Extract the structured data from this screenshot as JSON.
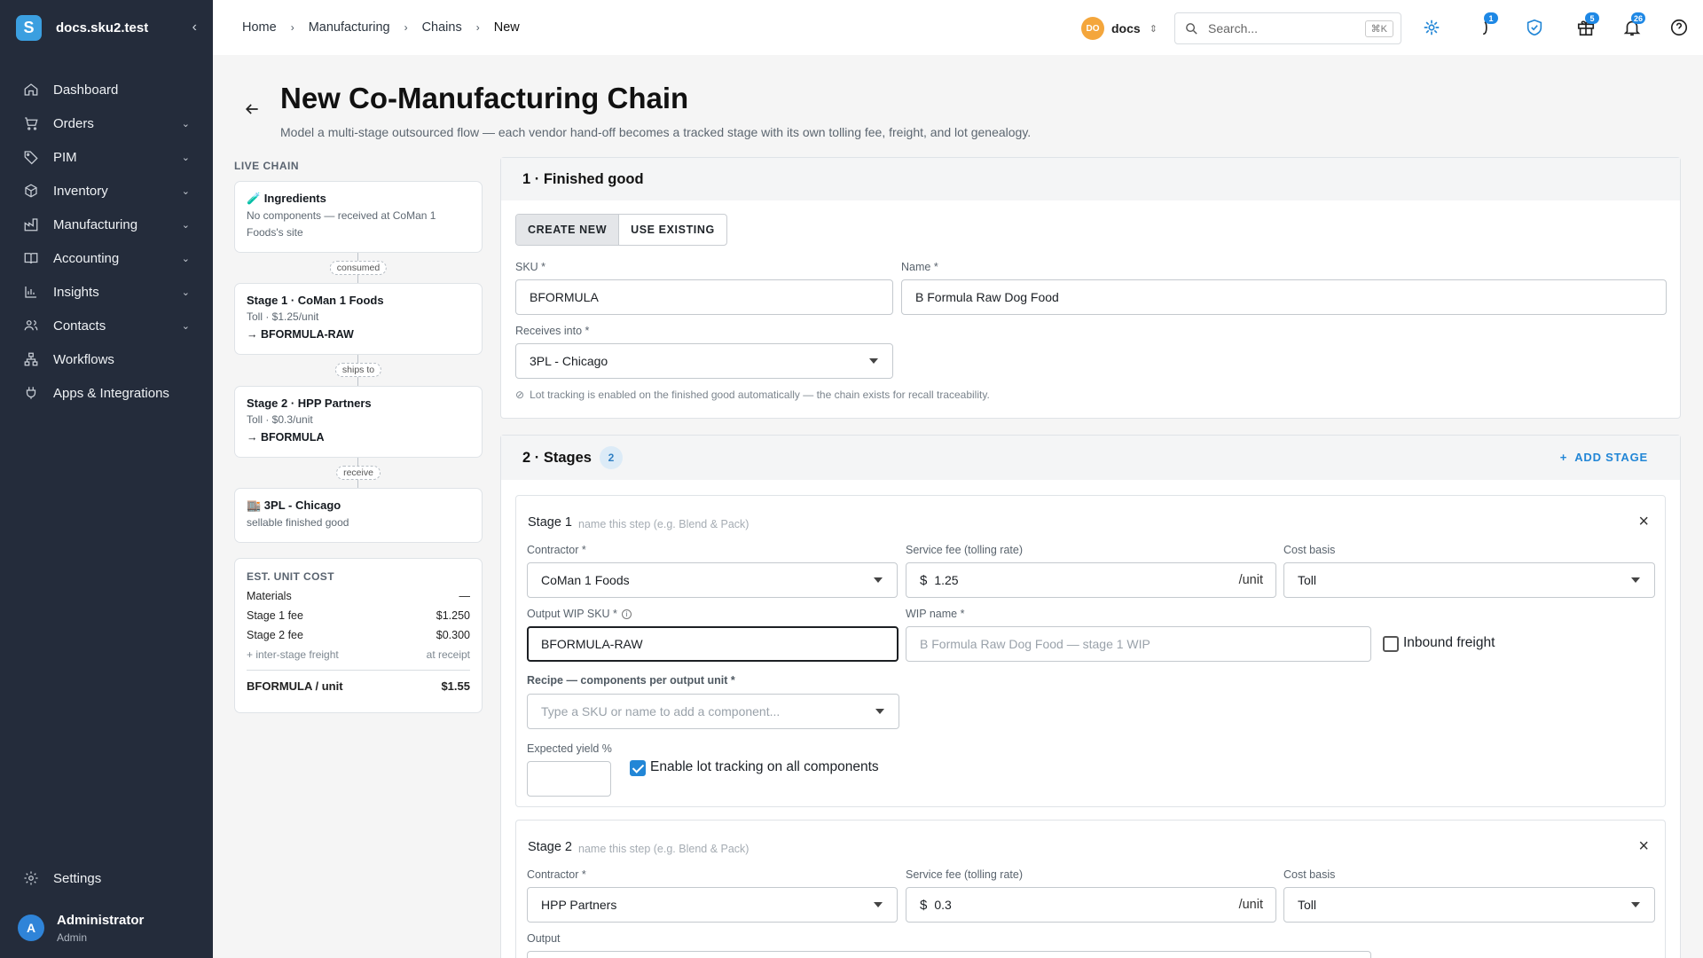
{
  "app": {
    "title": "docs.sku2.test",
    "logo_letter": "S"
  },
  "sidebar": {
    "items": [
      {
        "label": "Dashboard",
        "icon": "home-icon"
      },
      {
        "label": "Orders",
        "icon": "cart-icon"
      },
      {
        "label": "PIM",
        "icon": "tag-icon"
      },
      {
        "label": "Inventory",
        "icon": "box-icon"
      },
      {
        "label": "Manufacturing",
        "icon": "factory-icon"
      },
      {
        "label": "Accounting",
        "icon": "book-icon"
      },
      {
        "label": "Insights",
        "icon": "chart-icon"
      },
      {
        "label": "Contacts",
        "icon": "people-icon"
      },
      {
        "label": "Workflows",
        "icon": "workflow-icon"
      },
      {
        "label": "Apps & Integrations",
        "icon": "plug-icon"
      }
    ],
    "settings_label": "Settings",
    "user": {
      "initial": "A",
      "name": "Administrator",
      "role": "Admin"
    }
  },
  "topbar": {
    "breadcrumbs": [
      "Home",
      "Manufacturing",
      "Chains",
      "New"
    ],
    "workspace": {
      "initials": "DO",
      "name": "docs"
    },
    "search": {
      "placeholder": "Search...",
      "shortcut": "⌘K"
    },
    "badges": {
      "updates": "1",
      "gifts": "5",
      "notifications": "26"
    }
  },
  "page": {
    "title": "New Co-Manufacturing Chain",
    "subtitle": "Model a multi-stage outsourced flow — each vendor hand-off becomes a tracked stage with its own tolling fee, freight, and lot genealogy."
  },
  "live_chain": {
    "label": "LIVE CHAIN",
    "ingredients": {
      "title": "🧪 Ingredients",
      "desc": "No components — received at CoMan 1 Foods's site"
    },
    "connectors": [
      "consumed",
      "ships to",
      "receive"
    ],
    "stage1": {
      "title": "Stage 1 · CoMan 1 Foods",
      "desc": "Toll · $1.25/unit",
      "output": "→ BFORMULA-RAW"
    },
    "stage2": {
      "title": "Stage 2 · HPP Partners",
      "desc": "Toll · $0.3/unit",
      "output": "→ BFORMULA"
    },
    "dest": {
      "title": "🏬 3PL - Chicago",
      "desc": "sellable finished good"
    }
  },
  "est_cost": {
    "label": "EST. UNIT COST",
    "rows": [
      {
        "label": "Materials",
        "value": "—"
      },
      {
        "label": "Stage 1 fee",
        "value": "$1.250"
      },
      {
        "label": "Stage 2 fee",
        "value": "$0.300"
      }
    ],
    "freight": {
      "label": "+ inter-stage freight",
      "value": "at receipt"
    },
    "total": {
      "label": "BFORMULA / unit",
      "value": "$1.55"
    }
  },
  "finished_good": {
    "heading": "1 · Finished good",
    "toggle": {
      "create": "CREATE NEW",
      "existing": "USE EXISTING"
    },
    "sku_label": "SKU *",
    "sku": "BFORMULA",
    "name_label": "Name *",
    "name": "B Formula Raw Dog Food",
    "receives_label": "Receives into *",
    "receives": "3PL - Chicago",
    "hint": "Lot tracking is enabled on the finished good automatically — the chain exists for recall traceability."
  },
  "stages": {
    "heading": "2 · Stages",
    "count": "2",
    "add_label": "ADD STAGE",
    "stage1": {
      "title": "Stage 1",
      "name_placeholder": "name this step (e.g. Blend & Pack)",
      "contractor_label": "Contractor *",
      "contractor": "CoMan 1 Foods",
      "fee_label": "Service fee (tolling rate)",
      "fee_currency": "$",
      "fee": "1.25",
      "fee_unit": "/unit",
      "basis_label": "Cost basis",
      "basis": "Toll",
      "wip_sku_label": "Output WIP SKU *",
      "wip_sku": "BFORMULA-RAW",
      "wip_name_label": "WIP name *",
      "wip_name_placeholder": "B Formula Raw Dog Food — stage 1 WIP",
      "inbound_label": "Inbound freight",
      "recipe_label": "Recipe — components per output unit *",
      "recipe_placeholder": "Type a SKU or name to add a component...",
      "yield_label": "Expected yield %",
      "lot_label": "Enable lot tracking on all components"
    },
    "stage2": {
      "title": "Stage 2",
      "name_placeholder": "name this step (e.g. Blend & Pack)",
      "contractor_label": "Contractor *",
      "contractor": "HPP Partners",
      "fee_label": "Service fee (tolling rate)",
      "fee_currency": "$",
      "fee": "0.3",
      "fee_unit": "/unit",
      "basis_label": "Cost basis",
      "basis": "Toll",
      "output_label": "Output"
    }
  }
}
